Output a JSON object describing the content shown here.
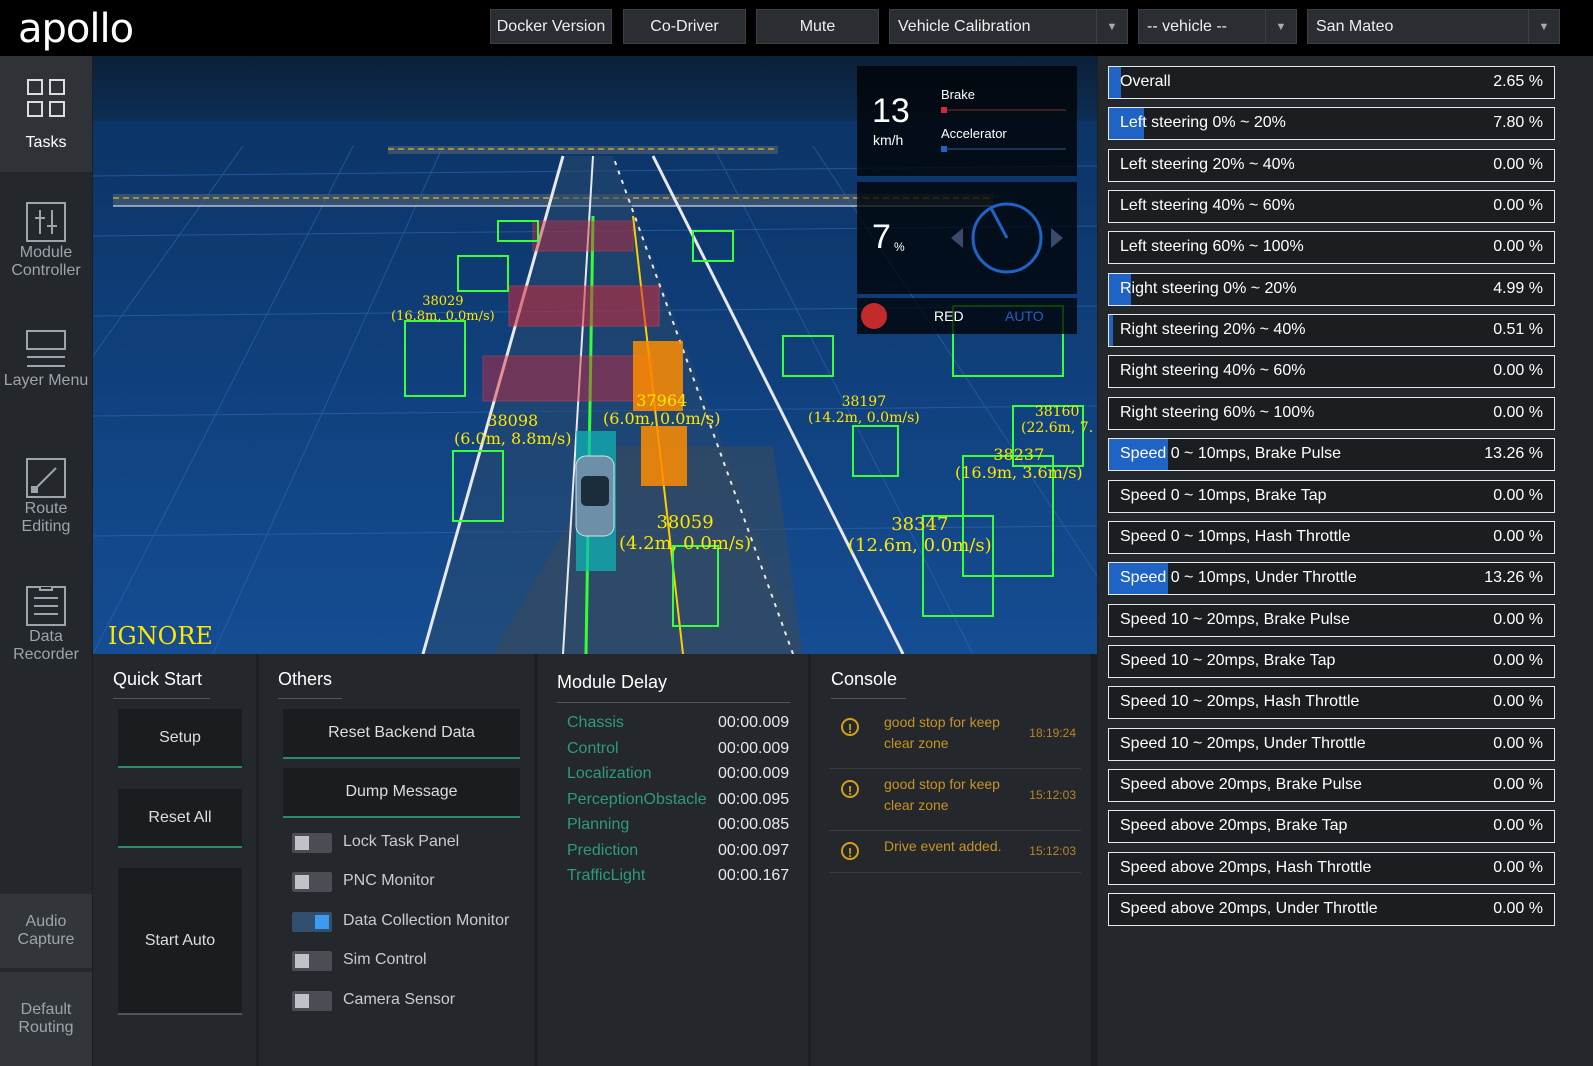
{
  "header": {
    "logo": "apollo",
    "buttons": [
      "Docker Version",
      "Co-Driver",
      "Mute"
    ],
    "mode_select": "Vehicle Calibration",
    "vehicle_select": "-- vehicle --",
    "map_select": "San Mateo"
  },
  "sidebar": {
    "items": [
      {
        "label": "Tasks",
        "icon": "tasks-icon"
      },
      {
        "label": "Module Controller",
        "icon": "module-controller-icon"
      },
      {
        "label": "Layer Menu",
        "icon": "layer-menu-icon"
      },
      {
        "label": "Route Editing",
        "icon": "route-editing-icon"
      },
      {
        "label": "Data Recorder",
        "icon": "data-recorder-icon"
      }
    ],
    "bottom": [
      "Audio Capture",
      "Default Routing"
    ]
  },
  "dashboard": {
    "speed": "13",
    "speed_unit": "km/h",
    "brake_label": "Brake",
    "accelerator_label": "Accelerator",
    "brake_level": 0.05,
    "accelerator_level": 0.03,
    "steering_value": "7",
    "steering_unit": "%",
    "traffic_light": "RED",
    "driving_mode": "AUTO"
  },
  "scene": {
    "ignore_label": "IGNORE",
    "obstacles": [
      {
        "id": "38098",
        "text": "(6.0m, 8.8m/s)"
      },
      {
        "id": "37964",
        "text": "(6.0m, 0.0m/s)"
      },
      {
        "id": "38059",
        "text": "(4.2m, 0.0m/s)"
      },
      {
        "id": "38237",
        "text": "(16.9m, 3.6m/s)"
      },
      {
        "id": "38347",
        "text": "(12.6m, 0.0m/s)"
      },
      {
        "id": "38197",
        "text": "(14.2m, 0.0m/s)"
      },
      {
        "id": "38029",
        "text": "(16.8m, 0.0m/s)"
      },
      {
        "id": "38160",
        "text": "(22.6m, 7."
      }
    ]
  },
  "quick_start": {
    "title": "Quick Start",
    "buttons": [
      "Setup",
      "Reset All",
      "Start Auto"
    ]
  },
  "others": {
    "title": "Others",
    "buttons": [
      "Reset Backend Data",
      "Dump Message"
    ],
    "toggles": [
      {
        "label": "Lock Task Panel",
        "on": false
      },
      {
        "label": "PNC Monitor",
        "on": false
      },
      {
        "label": "Data Collection Monitor",
        "on": true
      },
      {
        "label": "Sim Control",
        "on": false
      },
      {
        "label": "Camera Sensor",
        "on": false
      }
    ]
  },
  "module_delay": {
    "title": "Module Delay",
    "rows": [
      {
        "name": "Chassis",
        "value": "00:00.009"
      },
      {
        "name": "Control",
        "value": "00:00.009"
      },
      {
        "name": "Localization",
        "value": "00:00.009"
      },
      {
        "name": "PerceptionObstacle",
        "value": "00:00.095"
      },
      {
        "name": "Planning",
        "value": "00:00.085"
      },
      {
        "name": "Prediction",
        "value": "00:00.097"
      },
      {
        "name": "TrafficLight",
        "value": "00:00.167"
      }
    ]
  },
  "console": {
    "title": "Console",
    "messages": [
      {
        "text": "good stop for keep clear zone",
        "time": "18:19:24"
      },
      {
        "text": "good stop for keep clear zone",
        "time": "15:12:03"
      },
      {
        "text": "Drive event added.",
        "time": "15:12:03"
      }
    ]
  },
  "data_collection": {
    "rows": [
      {
        "name": "Overall",
        "value": "2.65 %",
        "fraction": 0.0265
      },
      {
        "name": "Left steering 0% ~ 20%",
        "value": "7.80 %",
        "fraction": 0.078
      },
      {
        "name": "Left steering 20% ~ 40%",
        "value": "0.00 %",
        "fraction": 0
      },
      {
        "name": "Left steering 40% ~ 60%",
        "value": "0.00 %",
        "fraction": 0
      },
      {
        "name": "Left steering 60% ~ 100%",
        "value": "0.00 %",
        "fraction": 0
      },
      {
        "name": "Right steering 0% ~ 20%",
        "value": "4.99 %",
        "fraction": 0.0499
      },
      {
        "name": "Right steering 20% ~ 40%",
        "value": "0.51 %",
        "fraction": 0.0051
      },
      {
        "name": "Right steering 40% ~ 60%",
        "value": "0.00 %",
        "fraction": 0
      },
      {
        "name": "Right steering 60% ~ 100%",
        "value": "0.00 %",
        "fraction": 0
      },
      {
        "name": "Speed 0 ~ 10mps, Brake Pulse",
        "value": "13.26 %",
        "fraction": 0.1326
      },
      {
        "name": "Speed 0 ~ 10mps, Brake Tap",
        "value": "0.00 %",
        "fraction": 0
      },
      {
        "name": "Speed 0 ~ 10mps, Hash Throttle",
        "value": "0.00 %",
        "fraction": 0
      },
      {
        "name": "Speed 0 ~ 10mps, Under Throttle",
        "value": "13.26 %",
        "fraction": 0.1326
      },
      {
        "name": "Speed 10 ~ 20mps, Brake Pulse",
        "value": "0.00 %",
        "fraction": 0
      },
      {
        "name": "Speed 10 ~ 20mps, Brake Tap",
        "value": "0.00 %",
        "fraction": 0
      },
      {
        "name": "Speed 10 ~ 20mps, Hash Throttle",
        "value": "0.00 %",
        "fraction": 0
      },
      {
        "name": "Speed 10 ~ 20mps, Under Throttle",
        "value": "0.00 %",
        "fraction": 0
      },
      {
        "name": "Speed above 20mps, Brake Pulse",
        "value": "0.00 %",
        "fraction": 0
      },
      {
        "name": "Speed above 20mps, Brake Tap",
        "value": "0.00 %",
        "fraction": 0
      },
      {
        "name": "Speed above 20mps, Hash Throttle",
        "value": "0.00 %",
        "fraction": 0
      },
      {
        "name": "Speed above 20mps, Under Throttle",
        "value": "0.00 %",
        "fraction": 0
      }
    ]
  },
  "colors": {
    "accent_blue": "#1f63c4",
    "module_green": "#2f9c77",
    "warning": "#c79424",
    "obstacle_green": "#39ff3a",
    "label_yellow": "#ffe600"
  }
}
